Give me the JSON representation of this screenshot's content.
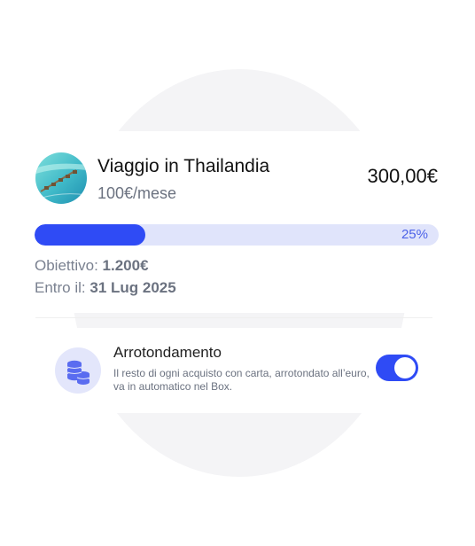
{
  "goal_card": {
    "image_alt": "overwater villas",
    "title": "Viaggio in Thailandia",
    "monthly": "100€/mese",
    "amount": "300,00€",
    "progress": {
      "fraction": 0.25,
      "label": "25%"
    },
    "target_label": "Obiettivo:",
    "target_value": "1.200€",
    "deadline_label": "Entro il:",
    "deadline_value": "31 Lug 2025"
  },
  "rounding": {
    "icon": "coins-icon",
    "title": "Arrotondamento",
    "description": "Il resto di ogni acquisto con carta, arrotondato all’euro, va in automatico nel Box.",
    "enabled": true
  },
  "colors": {
    "accent": "#2f4bf5",
    "track": "#e0e4fb",
    "background_shape": "#f4f4f6"
  }
}
